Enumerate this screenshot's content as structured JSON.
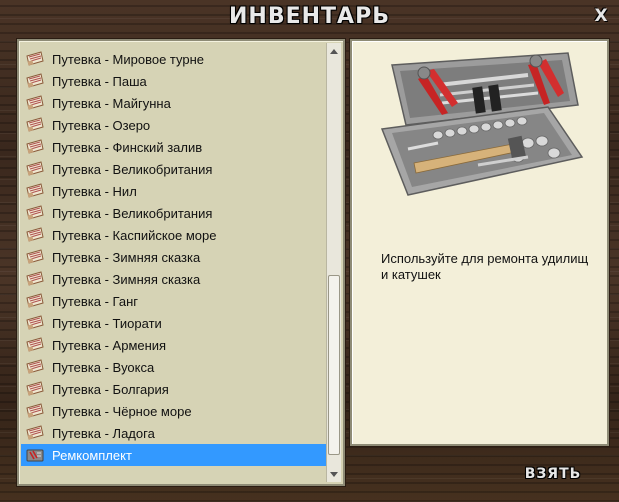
{
  "window": {
    "title": "ИНВЕНТАРЬ",
    "close_label": "X"
  },
  "inventory": {
    "items": [
      {
        "label": "Путевка - Мировое турне",
        "icon": "ticket-icon"
      },
      {
        "label": "Путевка - Паша",
        "icon": "ticket-icon"
      },
      {
        "label": "Путевка - Майгунна",
        "icon": "ticket-icon"
      },
      {
        "label": "Путевка - Озеро",
        "icon": "ticket-icon"
      },
      {
        "label": "Путевка - Финский залив",
        "icon": "ticket-icon"
      },
      {
        "label": "Путевка - Великобритания",
        "icon": "ticket-icon"
      },
      {
        "label": "Путевка - Нил",
        "icon": "ticket-icon"
      },
      {
        "label": "Путевка - Великобритания",
        "icon": "ticket-icon"
      },
      {
        "label": "Путевка - Каспийское море",
        "icon": "ticket-icon"
      },
      {
        "label": "Путевка - Зимняя сказка",
        "icon": "ticket-icon"
      },
      {
        "label": "Путевка - Зимняя сказка",
        "icon": "ticket-icon"
      },
      {
        "label": "Путевка - Ганг",
        "icon": "ticket-icon"
      },
      {
        "label": "Путевка - Тиорати",
        "icon": "ticket-icon"
      },
      {
        "label": "Путевка - Армения",
        "icon": "ticket-icon"
      },
      {
        "label": "Путевка - Вуокса",
        "icon": "ticket-icon"
      },
      {
        "label": "Путевка - Болгария",
        "icon": "ticket-icon"
      },
      {
        "label": "Путевка - Чёрное море",
        "icon": "ticket-icon"
      },
      {
        "label": "Путевка - Ладога",
        "icon": "ticket-icon"
      },
      {
        "label": "Ремкомплект",
        "icon": "repair-kit-icon",
        "selected": true
      }
    ],
    "scroll_position": 0.95
  },
  "detail": {
    "image": "toolkit-image",
    "description": "Используйте для ремонта удилищ и катушек"
  },
  "actions": {
    "take_label": "ВЗЯТЬ"
  },
  "colors": {
    "selection": "#3399ff",
    "list_background": "#d6d3b5",
    "detail_background": "#f3efd9"
  }
}
